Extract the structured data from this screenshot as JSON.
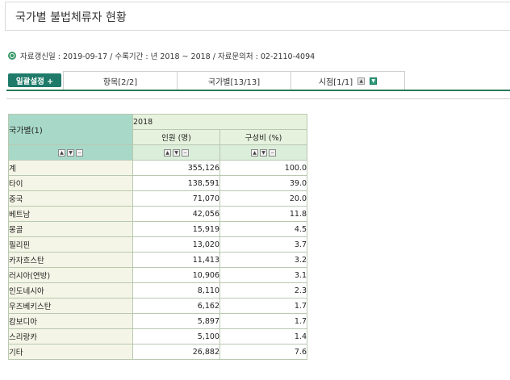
{
  "page": {
    "title": "국가별 불법체류자 현황",
    "meta_text": "자료갱신일 : 2019-09-17 / 수록기간 : 년 2018 ~ 2018 / 자료문의처 : 02-2110-4094"
  },
  "toolbar": {
    "setting_label": "일괄설정 +",
    "tabs": [
      "항목[2/2]",
      "국가별[13/13]",
      "시점[1/1]"
    ]
  },
  "table": {
    "corner_label": "국가별(1)",
    "year": "2018",
    "columns": [
      "인원 (명)",
      "구성비 (%)"
    ],
    "rows": [
      {
        "label": "계",
        "v1": "355,126",
        "v2": "100.0"
      },
      {
        "label": "타이",
        "v1": "138,591",
        "v2": "39.0"
      },
      {
        "label": "중국",
        "v1": "71,070",
        "v2": "20.0"
      },
      {
        "label": "베트남",
        "v1": "42,056",
        "v2": "11.8"
      },
      {
        "label": "몽골",
        "v1": "15,919",
        "v2": "4.5"
      },
      {
        "label": "필리핀",
        "v1": "13,020",
        "v2": "3.7"
      },
      {
        "label": "카자흐스탄",
        "v1": "11,413",
        "v2": "3.2"
      },
      {
        "label": "러시아(연방)",
        "v1": "10,906",
        "v2": "3.1"
      },
      {
        "label": "인도네시아",
        "v1": "8,110",
        "v2": "2.3"
      },
      {
        "label": "우즈베키스탄",
        "v1": "6,162",
        "v2": "1.7"
      },
      {
        "label": "캄보디아",
        "v1": "5,897",
        "v2": "1.7"
      },
      {
        "label": "스리랑카",
        "v1": "5,100",
        "v2": "1.4"
      },
      {
        "label": "기타",
        "v1": "26,882",
        "v2": "7.6"
      }
    ]
  }
}
